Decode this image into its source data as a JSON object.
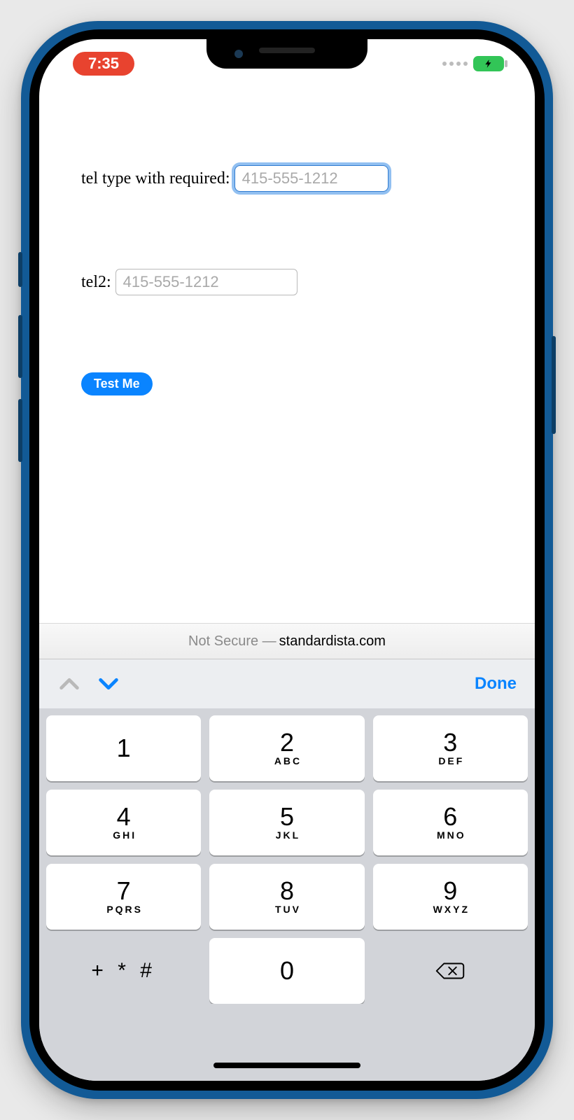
{
  "status": {
    "time": "7:35"
  },
  "form": {
    "field1_label": "tel type with required: ",
    "field1_placeholder": "415-555-1212",
    "field2_label": "tel2: ",
    "field2_placeholder": "415-555-1212",
    "button_label": "Test Me"
  },
  "urlbar": {
    "prefix": "Not Secure — ",
    "domain": "standardista.com"
  },
  "keyboard": {
    "done_label": "Done",
    "keys": [
      {
        "n": "1",
        "l": ""
      },
      {
        "n": "2",
        "l": "ABC"
      },
      {
        "n": "3",
        "l": "DEF"
      },
      {
        "n": "4",
        "l": "GHI"
      },
      {
        "n": "5",
        "l": "JKL"
      },
      {
        "n": "6",
        "l": "MNO"
      },
      {
        "n": "7",
        "l": "PQRS"
      },
      {
        "n": "8",
        "l": "TUV"
      },
      {
        "n": "9",
        "l": "WXYZ"
      }
    ],
    "symbols_label": "+ * #",
    "zero": "0"
  }
}
